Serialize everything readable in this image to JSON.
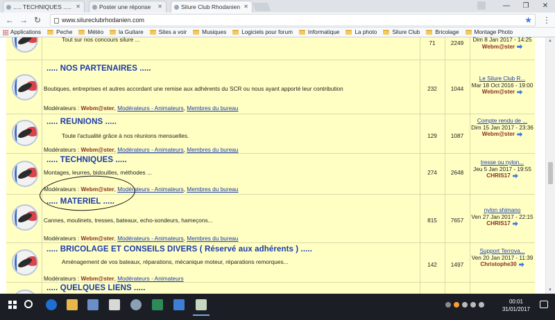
{
  "browser": {
    "tabs": [
      {
        "title": "..... TECHNIQUES ....."
      },
      {
        "title": "Poster une réponse"
      },
      {
        "title": "Silure Club Rhodanien"
      }
    ],
    "url": "www.silureclubrhodanien.com",
    "bookmarks": [
      "Applications",
      "Peche",
      "Météo",
      "la Guitare",
      "Sites a voir",
      "Musiques",
      "Logiciels pour forum",
      "Informatique",
      "La photo",
      "Silure Club",
      "Bricolage",
      "Montage Photo"
    ]
  },
  "forum": {
    "mods_label": "Modérateurs :",
    "mod_webmaster": "Webm@ster",
    "mod_group1": "Modérateurs - Animateurs",
    "mod_group2": "Membres du bureau",
    "rows": [
      {
        "desc": "Tout sur nos concours silure ...",
        "topics": "71",
        "posts": "2249",
        "last_date": "Dim 8 Jan 2017 - 14:25",
        "last_author": "Webm@ster"
      },
      {
        "title": "..... NOS PARTENAIRES .....",
        "desc": "Boutiques, entreprises et autres accordant une remise aux adhérents du SCR ou nous ayant apporté leur contribution",
        "topics": "232",
        "posts": "1044",
        "last_topic": "Le Silure Club R...",
        "last_date": "Mar 18 Oct 2016 - 19:00",
        "last_author": "Webm@ster"
      },
      {
        "title": "..... REUNIONS .....",
        "desc": "Toute l'actualité grâce à nos réunions mensuelles.",
        "topics": "129",
        "posts": "1087",
        "last_topic": "Compte rendu de ...",
        "last_date": "Dim 15 Jan 2017 - 23:36",
        "last_author": "Webm@ster"
      },
      {
        "title": "..... TECHNIQUES .....",
        "desc": "Montages, leurres, bidouilles, méthodes ...",
        "topics": "274",
        "posts": "2648",
        "last_topic": "tresse ou nylon...",
        "last_date": "Jeu 5 Jan 2017 - 19:55",
        "last_author": "CHRIS17"
      },
      {
        "title": "..... MATERIEL .....",
        "desc": "Cannes, moulinets, tresses, bateaux, echo-sondeurs, hameçons...",
        "topics": "815",
        "posts": "7657",
        "last_topic": "nylon shimano",
        "last_date": "Ven 27 Jan 2017 - 22:15",
        "last_author": "CHRIS17"
      },
      {
        "title": "..... BRICOLAGE ET CONSEILS DIVERS ( Réservé aux adhérents ) .....",
        "desc": "Aménagement de vos bateaux, réparations, mécanique moteur, réparations remorques...",
        "topics": "142",
        "posts": "1497",
        "last_topic": "Support Terrova...",
        "last_date": "Ven 20 Jan 2017 - 11:39",
        "last_author": "Christophe30"
      },
      {
        "title": "..... QUELQUES LIENS ....."
      }
    ]
  },
  "taskbar": {
    "time": "00:01",
    "date": "31/01/2017"
  }
}
